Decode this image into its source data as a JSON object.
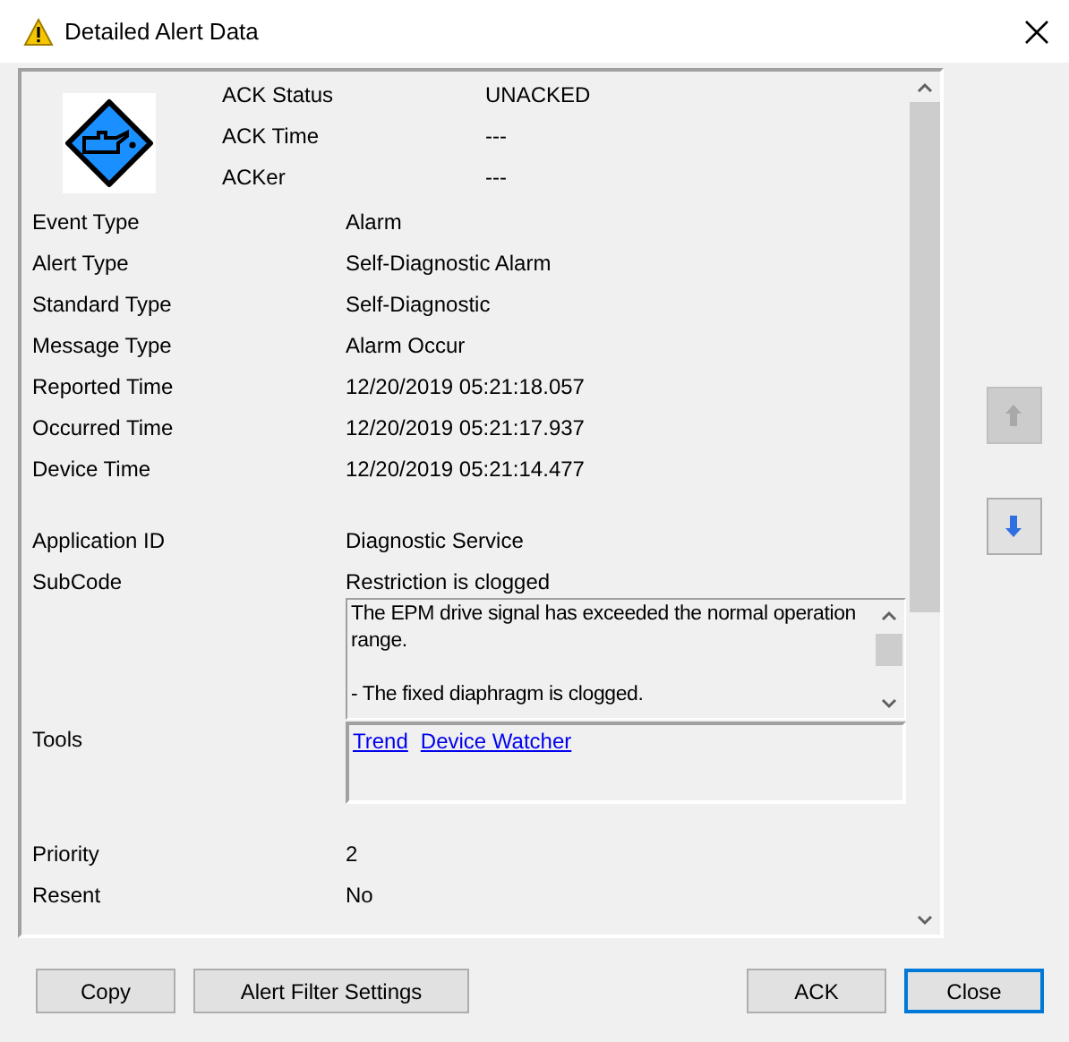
{
  "window": {
    "title": "Detailed Alert Data"
  },
  "ack": [
    {
      "label": "ACK Status",
      "value": "UNACKED"
    },
    {
      "label": "ACK Time",
      "value": "---"
    },
    {
      "label": "ACKer",
      "value": "---"
    }
  ],
  "sections": [
    {
      "fields": [
        {
          "kind": "text",
          "label": "Event Type",
          "value": "Alarm"
        },
        {
          "kind": "text",
          "label": "Alert Type",
          "value": "Self-Diagnostic Alarm"
        },
        {
          "kind": "text",
          "label": "Standard Type",
          "value": "Self-Diagnostic"
        },
        {
          "kind": "text",
          "label": "Message Type",
          "value": "Alarm Occur"
        },
        {
          "kind": "text",
          "label": "Reported Time",
          "value": "12/20/2019 05:21:18.057"
        },
        {
          "kind": "text",
          "label": "Occurred Time",
          "value": "12/20/2019 05:21:17.937"
        },
        {
          "kind": "text",
          "label": "Device Time",
          "value": "12/20/2019 05:21:14.477"
        }
      ]
    },
    {
      "fields": [
        {
          "kind": "text",
          "label": "Application ID",
          "value": "Diagnostic Service"
        },
        {
          "kind": "memo",
          "label": "SubCode",
          "value": "Restriction is clogged",
          "paragraphs": [
            "The EPM drive signal has exceeded the normal operation range.",
            "- The fixed diaphragm is clogged."
          ]
        },
        {
          "kind": "links",
          "label": "Tools",
          "links": [
            "Trend",
            "Device Watcher"
          ]
        }
      ]
    },
    {
      "fields": [
        {
          "kind": "text",
          "label": "Priority",
          "value": "2"
        },
        {
          "kind": "text",
          "label": "Resent",
          "value": "No"
        }
      ]
    }
  ],
  "nav": [
    {
      "kind": "up",
      "disabled": true
    },
    {
      "kind": "down",
      "disabled": false
    }
  ],
  "buttons": [
    {
      "label": "Copy",
      "default": false
    },
    {
      "label": "Alert Filter Settings",
      "default": false
    },
    {
      "label": "ACK",
      "default": false
    },
    {
      "label": "Close",
      "default": true
    }
  ]
}
